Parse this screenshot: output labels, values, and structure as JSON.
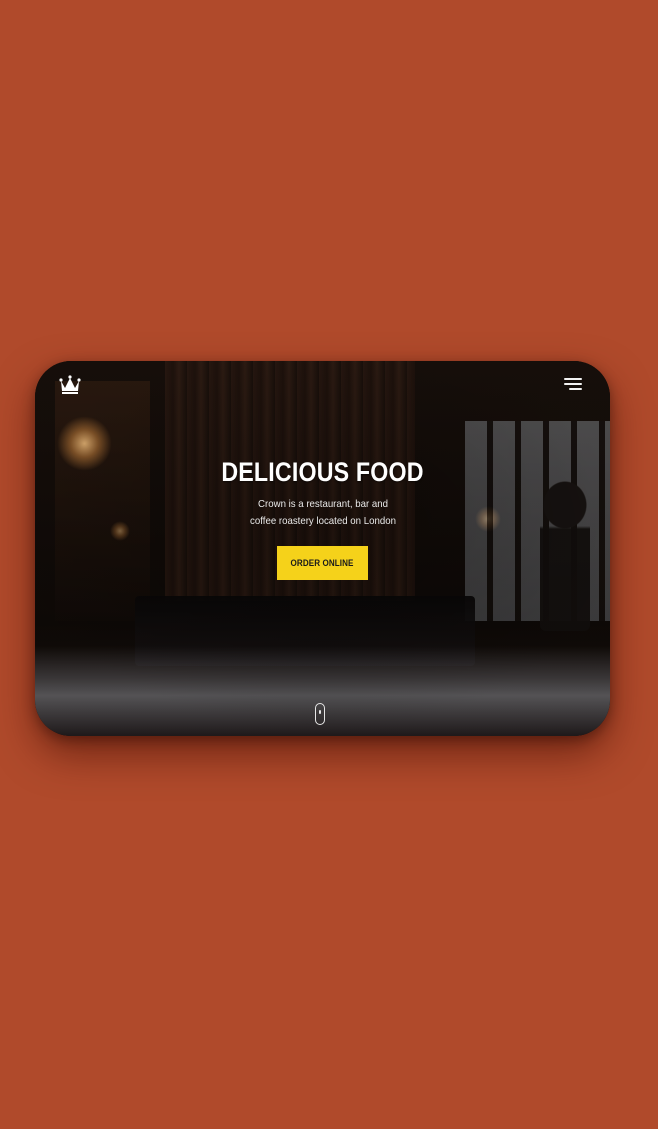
{
  "page": {
    "background_color": "#b04a2b"
  },
  "header": {
    "logo_icon": "crown-icon",
    "menu_icon": "hamburger-menu-icon"
  },
  "hero": {
    "title": "DELICIOUS FOOD",
    "subtitle": "Crown is a restaurant, bar and coffee roastery located on London",
    "cta_label": "ORDER ONLINE",
    "cta_color": "#f5d21a"
  },
  "scroll_indicator": {
    "icon": "mouse-scroll-icon"
  }
}
